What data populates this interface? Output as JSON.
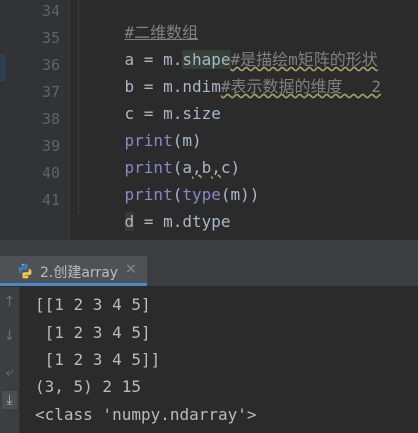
{
  "editor": {
    "lines": [
      {
        "num": "34",
        "code": "#二维数组"
      },
      {
        "num": "35",
        "code_a": "a = m.",
        "code_b": "shape",
        "code_c": "#是描绘m矩阵的形状"
      },
      {
        "num": "36",
        "code_a": "b = m.ndim",
        "code_b": "#表示数据的维度   2"
      },
      {
        "num": "37",
        "code": "c = m.size"
      },
      {
        "num": "38",
        "kw": "print",
        "rest": "(m)"
      },
      {
        "num": "39",
        "kw": "print",
        "p1": "(a",
        "c1": ",",
        "p2": "b",
        "c2": ",",
        "p3": "c)"
      },
      {
        "num": "40",
        "kw": "print",
        "p1": "(",
        "kw2": "type",
        "p2": "(m))"
      },
      {
        "num": "41",
        "d": "d",
        "rest": " = m.dtype"
      }
    ]
  },
  "run_panel": {
    "tab_label": "2.创建array",
    "close_glyph": "×",
    "output": [
      "[[1 2 3 4 5]",
      " [1 2 3 4 5]",
      " [1 2 3 4 5]]",
      "(3, 5) 2 15",
      "<class 'numpy.ndarray'>"
    ]
  },
  "toolbar": {
    "up_icon": "↑",
    "down_icon": "↓",
    "wrap_icon": "⤶",
    "scroll_end_icon": "⤓"
  },
  "colors": {
    "editor_bg": "#2b2b2b",
    "gutter_bg": "#313335",
    "comment": "#808080",
    "keyword": "#8888c6",
    "code": "#a9b7c6",
    "tab_accent": "#4a88c7"
  }
}
